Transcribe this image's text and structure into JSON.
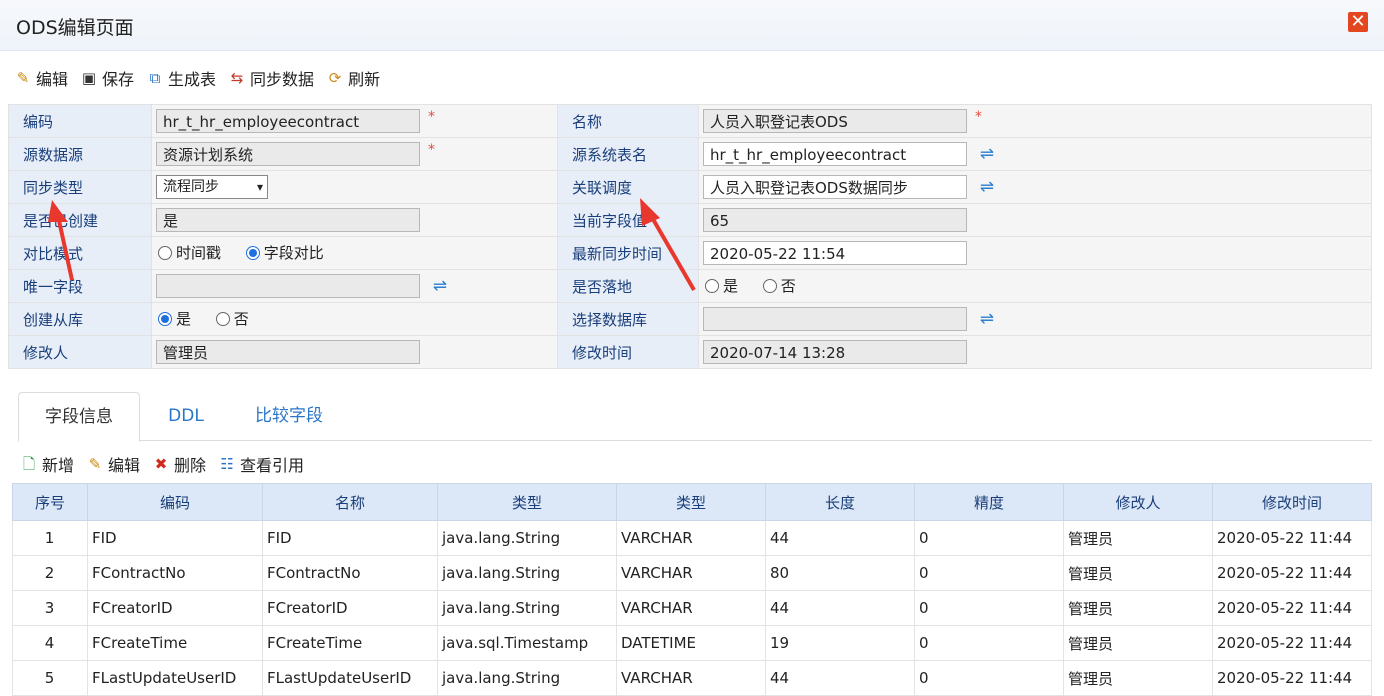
{
  "window": {
    "title": "ODS编辑页面",
    "close_label": "✕"
  },
  "toolbar": {
    "edit": "编辑",
    "save": "保存",
    "gen_table": "生成表",
    "sync_data": "同步数据",
    "refresh": "刷新"
  },
  "form": {
    "code_label": "编码",
    "code_value": "hr_t_hr_employeecontract",
    "name_label": "名称",
    "name_value": "人员入职登记表ODS",
    "source_label": "源数据源",
    "source_value": "资源计划系统",
    "src_table_label": "源系统表名",
    "src_table_value": "hr_t_hr_employeecontract",
    "sync_type_label": "同步类型",
    "sync_type_value": "流程同步",
    "related_label": "关联调度",
    "related_value": "人员入职登记表ODS数据同步",
    "created_label": "是否已创建",
    "created_value": "是",
    "cur_field_label": "当前字段值",
    "cur_field_value": "65",
    "compare_label": "对比模式",
    "compare_opt1": "时间戳",
    "compare_opt2": "字段对比",
    "latest_sync_label": "最新同步时间",
    "latest_sync_value": "2020-05-22 11:54",
    "unique_label": "唯一字段",
    "unique_value": "",
    "landing_label": "是否落地",
    "landing_yes": "是",
    "landing_no": "否",
    "replica_label": "创建从库",
    "replica_yes": "是",
    "replica_no": "否",
    "select_db_label": "选择数据库",
    "select_db_value": "",
    "modifier_label": "修改人",
    "modifier_value": "管理员",
    "modify_time_label": "修改时间",
    "modify_time_value": "2020-07-14 13:28",
    "required_mark": "*"
  },
  "tabs": [
    "字段信息",
    "DDL",
    "比较字段"
  ],
  "toolbar2": {
    "add": "新增",
    "edit": "编辑",
    "delete": "删除",
    "view_ref": "查看引用"
  },
  "grid": {
    "headers": [
      "序号",
      "编码",
      "名称",
      "类型",
      "类型",
      "长度",
      "精度",
      "修改人",
      "修改时间"
    ],
    "rows": [
      [
        "1",
        "FID",
        "FID",
        "java.lang.String",
        "VARCHAR",
        "44",
        "0",
        "管理员",
        "2020-05-22 11:44"
      ],
      [
        "2",
        "FContractNo",
        "FContractNo",
        "java.lang.String",
        "VARCHAR",
        "80",
        "0",
        "管理员",
        "2020-05-22 11:44"
      ],
      [
        "3",
        "FCreatorID",
        "FCreatorID",
        "java.lang.String",
        "VARCHAR",
        "44",
        "0",
        "管理员",
        "2020-05-22 11:44"
      ],
      [
        "4",
        "FCreateTime",
        "FCreateTime",
        "java.sql.Timestamp",
        "DATETIME",
        "19",
        "0",
        "管理员",
        "2020-05-22 11:44"
      ],
      [
        "5",
        "FLastUpdateUserID",
        "FLastUpdateUserID",
        "java.lang.String",
        "VARCHAR",
        "44",
        "0",
        "管理员",
        "2020-05-22 11:44"
      ]
    ]
  },
  "colors": {
    "accent": "#2a75c9",
    "label_bg": "#e7eef8",
    "header_bg": "#dce8f7",
    "annotation": "#e8372c"
  }
}
